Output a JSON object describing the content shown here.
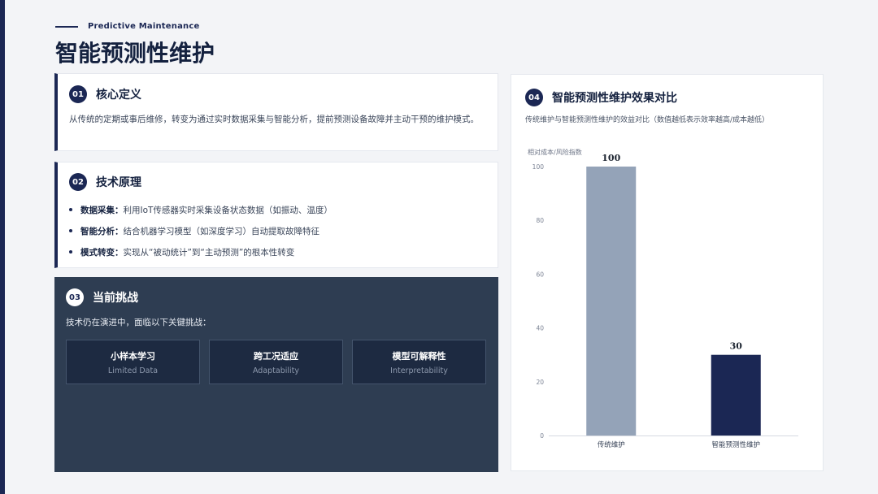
{
  "header": {
    "eyebrow": "Predictive Maintenance",
    "title": "智能预测性维护"
  },
  "definition": {
    "num": "01",
    "title": "核心定义",
    "text": "从传统的定期或事后维修，转变为通过实时数据采集与智能分析，提前预测设备故障并主动干预的维护模式。"
  },
  "principles": {
    "num": "02",
    "title": "技术原理",
    "items": [
      {
        "key": "数据采集：",
        "text": "利用IoT传感器实时采集设备状态数据（如振动、温度）"
      },
      {
        "key": "智能分析：",
        "text": "结合机器学习模型（如深度学习）自动提取故障特征"
      },
      {
        "key": "模式转变：",
        "text": "实现从“被动统计”到“主动预测”的根本性转变"
      }
    ]
  },
  "challenges": {
    "num": "03",
    "title": "当前挑战",
    "intro": "技术仍在演进中，面临以下关键挑战：",
    "items": [
      {
        "zh": "小样本学习",
        "en": "Limited Data"
      },
      {
        "zh": "跨工况适应",
        "en": "Adaptability"
      },
      {
        "zh": "模型可解释性",
        "en": "Interpretability"
      }
    ]
  },
  "comparison": {
    "num": "04",
    "title": "智能预测性维护效果对比",
    "subtitle": "传统维护与智能预测性维护的效益对比（数值越低表示效率越高/成本越低）"
  },
  "chart_data": {
    "type": "bar",
    "categories": [
      "传统维护",
      "智能预测性维护"
    ],
    "values": [
      100,
      30
    ],
    "ylabel": "相对成本/风险指数",
    "ylim": [
      0,
      100
    ],
    "yticks": [
      0,
      20,
      40,
      60,
      80,
      100
    ],
    "colors": [
      "#94a3b8",
      "#1b2754"
    ],
    "data_labels": true,
    "grid": false
  }
}
